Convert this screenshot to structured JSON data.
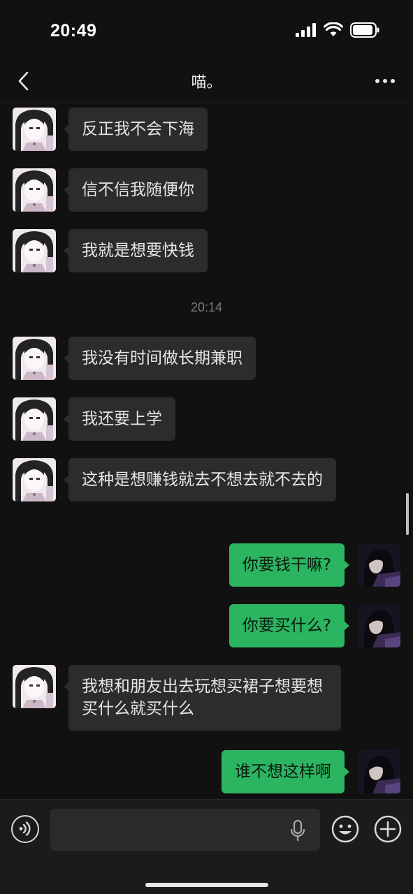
{
  "status_bar": {
    "time": "20:49"
  },
  "header": {
    "title": "喵。"
  },
  "messages": [
    {
      "side": "in",
      "text": "反正我不会下海"
    },
    {
      "side": "in",
      "text": "信不信我随便你"
    },
    {
      "side": "in",
      "text": "我就是想要快钱"
    },
    {
      "timestamp": "20:14"
    },
    {
      "side": "in",
      "text": "我没有时间做长期兼职"
    },
    {
      "side": "in",
      "text": "我还要上学"
    },
    {
      "side": "in",
      "text": "这种是想赚钱就去不想去就不去的"
    },
    {
      "side": "out",
      "text": "你要钱干嘛?"
    },
    {
      "side": "out",
      "text": "你要买什么?"
    },
    {
      "side": "in",
      "text": "我想和朋友出去玩想买裙子想要想买什么就买什么"
    },
    {
      "side": "out",
      "text": "谁不想这样啊"
    }
  ],
  "input_bar": {
    "placeholder": "",
    "value": ""
  },
  "icons": {
    "back": "chevron-left-icon",
    "more": "more-horizontal-icon",
    "voice": "voice-icon",
    "mic": "microphone-icon",
    "emoji": "emoji-icon",
    "plus": "plus-circle-icon"
  },
  "colors": {
    "background": "#111111",
    "incoming_bubble": "#2c2c2c",
    "outgoing_bubble": "#2bb560"
  }
}
